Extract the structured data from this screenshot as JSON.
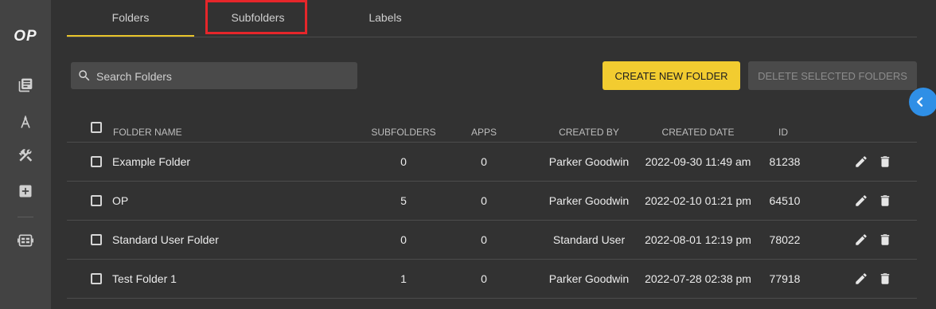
{
  "sidebar": {
    "logo": "OP",
    "icons": [
      "library-icon",
      "compass-icon",
      "tools-icon",
      "add-box-icon",
      "dashboard-icon"
    ]
  },
  "tabs": [
    {
      "label": "Folders",
      "active": true
    },
    {
      "label": "Subfolders",
      "active": false,
      "highlighted": true
    },
    {
      "label": "Labels",
      "active": false
    }
  ],
  "search": {
    "placeholder": "Search Folders",
    "value": ""
  },
  "buttons": {
    "create": "CREATE NEW FOLDER",
    "delete": "DELETE SELECTED FOLDERS"
  },
  "table": {
    "headers": {
      "name": "FOLDER NAME",
      "subfolders": "SUBFOLDERS",
      "apps": "APPS",
      "created_by": "CREATED BY",
      "created_date": "CREATED DATE",
      "id": "ID"
    },
    "rows": [
      {
        "name": "Example Folder",
        "subfolders": "0",
        "apps": "0",
        "created_by": "Parker Goodwin",
        "created_date": "2022-09-30 11:49 am",
        "id": "81238"
      },
      {
        "name": "OP",
        "subfolders": "5",
        "apps": "0",
        "created_by": "Parker Goodwin",
        "created_date": "2022-02-10 01:21 pm",
        "id": "64510"
      },
      {
        "name": "Standard User Folder",
        "subfolders": "0",
        "apps": "0",
        "created_by": "Standard User",
        "created_date": "2022-08-01 12:19 pm",
        "id": "78022"
      },
      {
        "name": "Test Folder 1",
        "subfolders": "1",
        "apps": "0",
        "created_by": "Parker Goodwin",
        "created_date": "2022-07-28 02:38 pm",
        "id": "77918"
      }
    ]
  },
  "colors": {
    "accent": "#f2cc30",
    "highlight_box": "#e6262a",
    "collapse_button": "#2f8fe6",
    "background": "#323232",
    "sidebar": "#434343"
  }
}
